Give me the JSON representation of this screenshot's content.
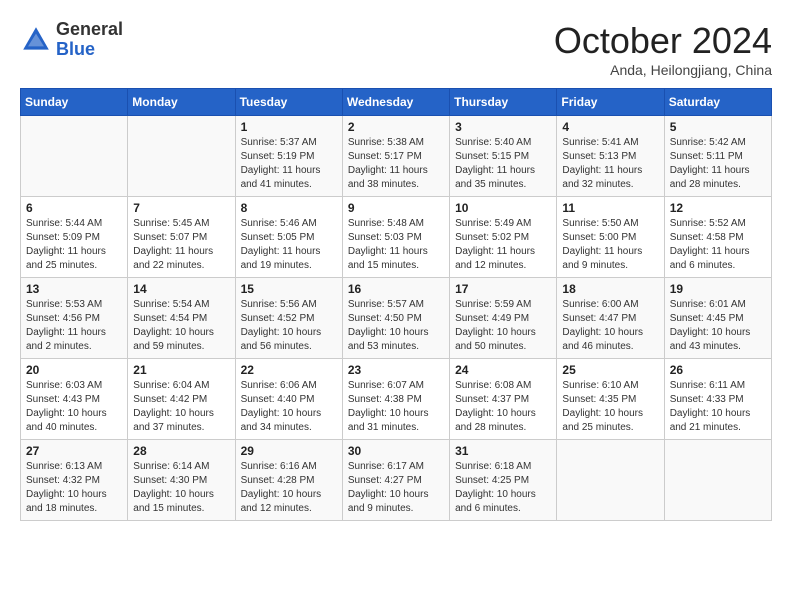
{
  "header": {
    "logo_line1": "General",
    "logo_line2": "Blue",
    "month_title": "October 2024",
    "subtitle": "Anda, Heilongjiang, China"
  },
  "weekdays": [
    "Sunday",
    "Monday",
    "Tuesday",
    "Wednesday",
    "Thursday",
    "Friday",
    "Saturday"
  ],
  "weeks": [
    [
      {
        "day": "",
        "info": ""
      },
      {
        "day": "",
        "info": ""
      },
      {
        "day": "1",
        "info": "Sunrise: 5:37 AM\nSunset: 5:19 PM\nDaylight: 11 hours and 41 minutes."
      },
      {
        "day": "2",
        "info": "Sunrise: 5:38 AM\nSunset: 5:17 PM\nDaylight: 11 hours and 38 minutes."
      },
      {
        "day": "3",
        "info": "Sunrise: 5:40 AM\nSunset: 5:15 PM\nDaylight: 11 hours and 35 minutes."
      },
      {
        "day": "4",
        "info": "Sunrise: 5:41 AM\nSunset: 5:13 PM\nDaylight: 11 hours and 32 minutes."
      },
      {
        "day": "5",
        "info": "Sunrise: 5:42 AM\nSunset: 5:11 PM\nDaylight: 11 hours and 28 minutes."
      }
    ],
    [
      {
        "day": "6",
        "info": "Sunrise: 5:44 AM\nSunset: 5:09 PM\nDaylight: 11 hours and 25 minutes."
      },
      {
        "day": "7",
        "info": "Sunrise: 5:45 AM\nSunset: 5:07 PM\nDaylight: 11 hours and 22 minutes."
      },
      {
        "day": "8",
        "info": "Sunrise: 5:46 AM\nSunset: 5:05 PM\nDaylight: 11 hours and 19 minutes."
      },
      {
        "day": "9",
        "info": "Sunrise: 5:48 AM\nSunset: 5:03 PM\nDaylight: 11 hours and 15 minutes."
      },
      {
        "day": "10",
        "info": "Sunrise: 5:49 AM\nSunset: 5:02 PM\nDaylight: 11 hours and 12 minutes."
      },
      {
        "day": "11",
        "info": "Sunrise: 5:50 AM\nSunset: 5:00 PM\nDaylight: 11 hours and 9 minutes."
      },
      {
        "day": "12",
        "info": "Sunrise: 5:52 AM\nSunset: 4:58 PM\nDaylight: 11 hours and 6 minutes."
      }
    ],
    [
      {
        "day": "13",
        "info": "Sunrise: 5:53 AM\nSunset: 4:56 PM\nDaylight: 11 hours and 2 minutes."
      },
      {
        "day": "14",
        "info": "Sunrise: 5:54 AM\nSunset: 4:54 PM\nDaylight: 10 hours and 59 minutes."
      },
      {
        "day": "15",
        "info": "Sunrise: 5:56 AM\nSunset: 4:52 PM\nDaylight: 10 hours and 56 minutes."
      },
      {
        "day": "16",
        "info": "Sunrise: 5:57 AM\nSunset: 4:50 PM\nDaylight: 10 hours and 53 minutes."
      },
      {
        "day": "17",
        "info": "Sunrise: 5:59 AM\nSunset: 4:49 PM\nDaylight: 10 hours and 50 minutes."
      },
      {
        "day": "18",
        "info": "Sunrise: 6:00 AM\nSunset: 4:47 PM\nDaylight: 10 hours and 46 minutes."
      },
      {
        "day": "19",
        "info": "Sunrise: 6:01 AM\nSunset: 4:45 PM\nDaylight: 10 hours and 43 minutes."
      }
    ],
    [
      {
        "day": "20",
        "info": "Sunrise: 6:03 AM\nSunset: 4:43 PM\nDaylight: 10 hours and 40 minutes."
      },
      {
        "day": "21",
        "info": "Sunrise: 6:04 AM\nSunset: 4:42 PM\nDaylight: 10 hours and 37 minutes."
      },
      {
        "day": "22",
        "info": "Sunrise: 6:06 AM\nSunset: 4:40 PM\nDaylight: 10 hours and 34 minutes."
      },
      {
        "day": "23",
        "info": "Sunrise: 6:07 AM\nSunset: 4:38 PM\nDaylight: 10 hours and 31 minutes."
      },
      {
        "day": "24",
        "info": "Sunrise: 6:08 AM\nSunset: 4:37 PM\nDaylight: 10 hours and 28 minutes."
      },
      {
        "day": "25",
        "info": "Sunrise: 6:10 AM\nSunset: 4:35 PM\nDaylight: 10 hours and 25 minutes."
      },
      {
        "day": "26",
        "info": "Sunrise: 6:11 AM\nSunset: 4:33 PM\nDaylight: 10 hours and 21 minutes."
      }
    ],
    [
      {
        "day": "27",
        "info": "Sunrise: 6:13 AM\nSunset: 4:32 PM\nDaylight: 10 hours and 18 minutes."
      },
      {
        "day": "28",
        "info": "Sunrise: 6:14 AM\nSunset: 4:30 PM\nDaylight: 10 hours and 15 minutes."
      },
      {
        "day": "29",
        "info": "Sunrise: 6:16 AM\nSunset: 4:28 PM\nDaylight: 10 hours and 12 minutes."
      },
      {
        "day": "30",
        "info": "Sunrise: 6:17 AM\nSunset: 4:27 PM\nDaylight: 10 hours and 9 minutes."
      },
      {
        "day": "31",
        "info": "Sunrise: 6:18 AM\nSunset: 4:25 PM\nDaylight: 10 hours and 6 minutes."
      },
      {
        "day": "",
        "info": ""
      },
      {
        "day": "",
        "info": ""
      }
    ]
  ]
}
